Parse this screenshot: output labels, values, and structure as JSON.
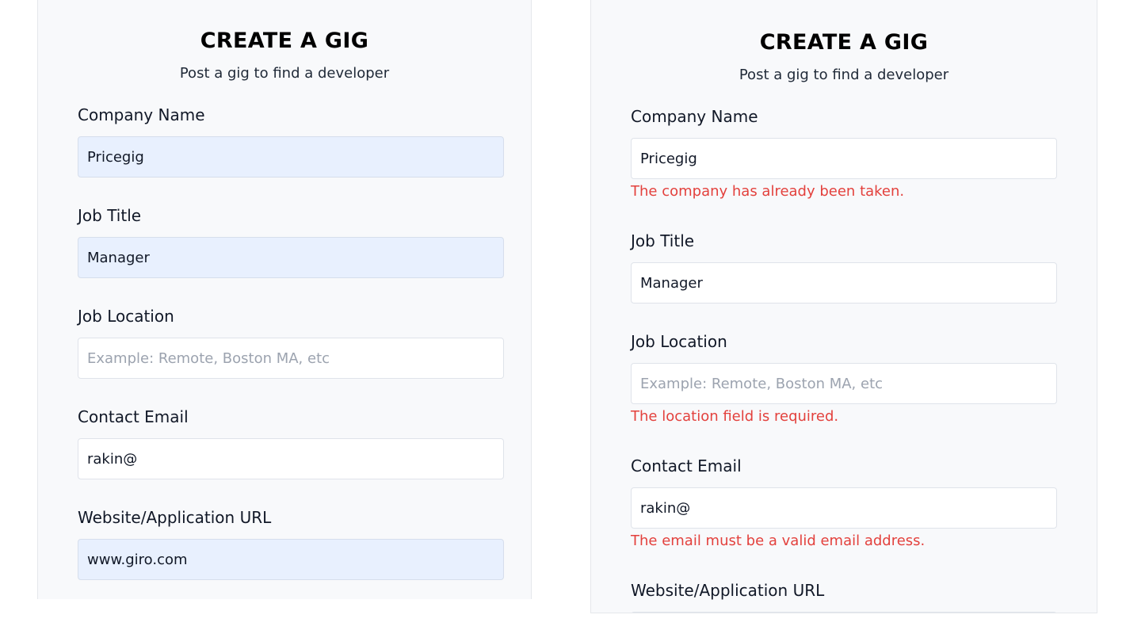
{
  "left_form": {
    "title": "CREATE A GIG",
    "subtitle": "Post a gig to find a developer",
    "company_label": "Company Name",
    "company_value": "Pricegig",
    "job_title_label": "Job Title",
    "job_title_value": "Manager",
    "location_label": "Job Location",
    "location_placeholder": "Example: Remote, Boston MA, etc",
    "email_label": "Contact Email",
    "email_value": "rakin@",
    "url_label": "Website/Application URL",
    "url_value": "www.giro.com"
  },
  "right_form": {
    "title": "CREATE A GIG",
    "subtitle": "Post a gig to find a developer",
    "company_label": "Company Name",
    "company_value": "Pricegig",
    "company_error": "The company has already been taken.",
    "job_title_label": "Job Title",
    "job_title_value": "Manager",
    "location_label": "Job Location",
    "location_placeholder": "Example: Remote, Boston MA, etc",
    "location_error": "The location field is required.",
    "email_label": "Contact Email",
    "email_value": "rakin@",
    "email_error": "The email must be a valid email address.",
    "url_label": "Website/Application URL"
  },
  "colors": {
    "panel_background": "#f8f9fb",
    "autofill_background": "#e8f0fe",
    "error_text": "#e3413d"
  }
}
